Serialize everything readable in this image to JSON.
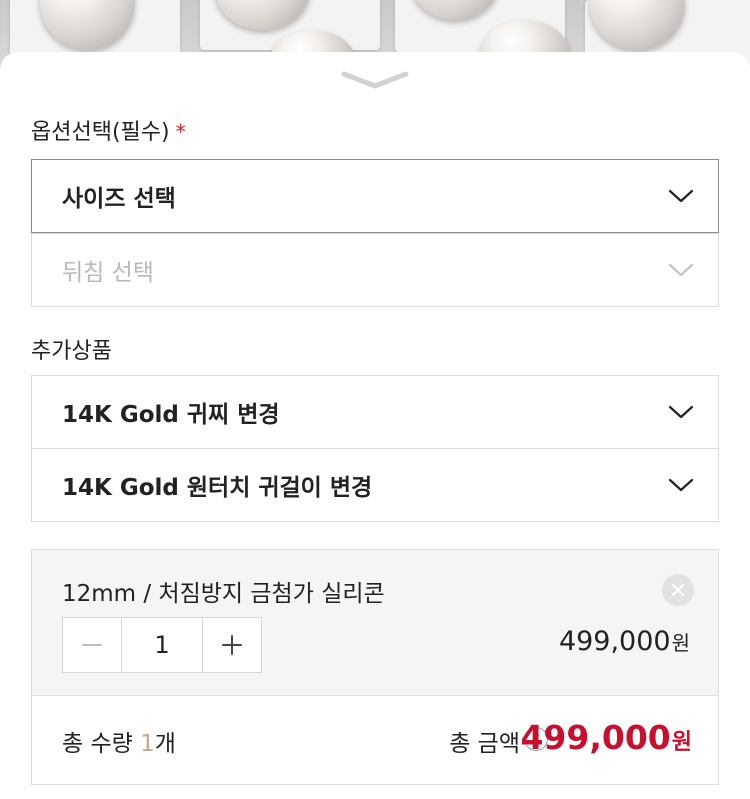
{
  "option_section": {
    "label": "옵션선택(필수)",
    "required_mark": "*",
    "size_select": {
      "value": "사이즈 선택"
    },
    "flip_select": {
      "value": "뒤침 선택"
    }
  },
  "addon_section": {
    "label": "추가상품",
    "items": [
      {
        "value": "14K Gold 귀찌 변경"
      },
      {
        "value": "14K Gold 원터치 귀걸이 변경"
      }
    ]
  },
  "selected_item": {
    "name": "12mm / 처짐방지 금첨가 실리콘",
    "quantity": "1",
    "price": "499,000",
    "price_unit": "원"
  },
  "totals": {
    "qty_prefix": "총 수량 ",
    "qty_value": "1",
    "qty_suffix": "개",
    "amount_label": "총 금액",
    "help_symbol": "?",
    "amount": "499,000",
    "amount_unit": "원"
  },
  "colors": {
    "accent_red": "#c8102e",
    "required_red": "#e02020",
    "qty_highlight": "#c7a98a"
  },
  "icons": [
    "chevron-down-icon",
    "close-icon",
    "minus-icon",
    "plus-icon",
    "help-icon",
    "sheet-handle-icon"
  ]
}
